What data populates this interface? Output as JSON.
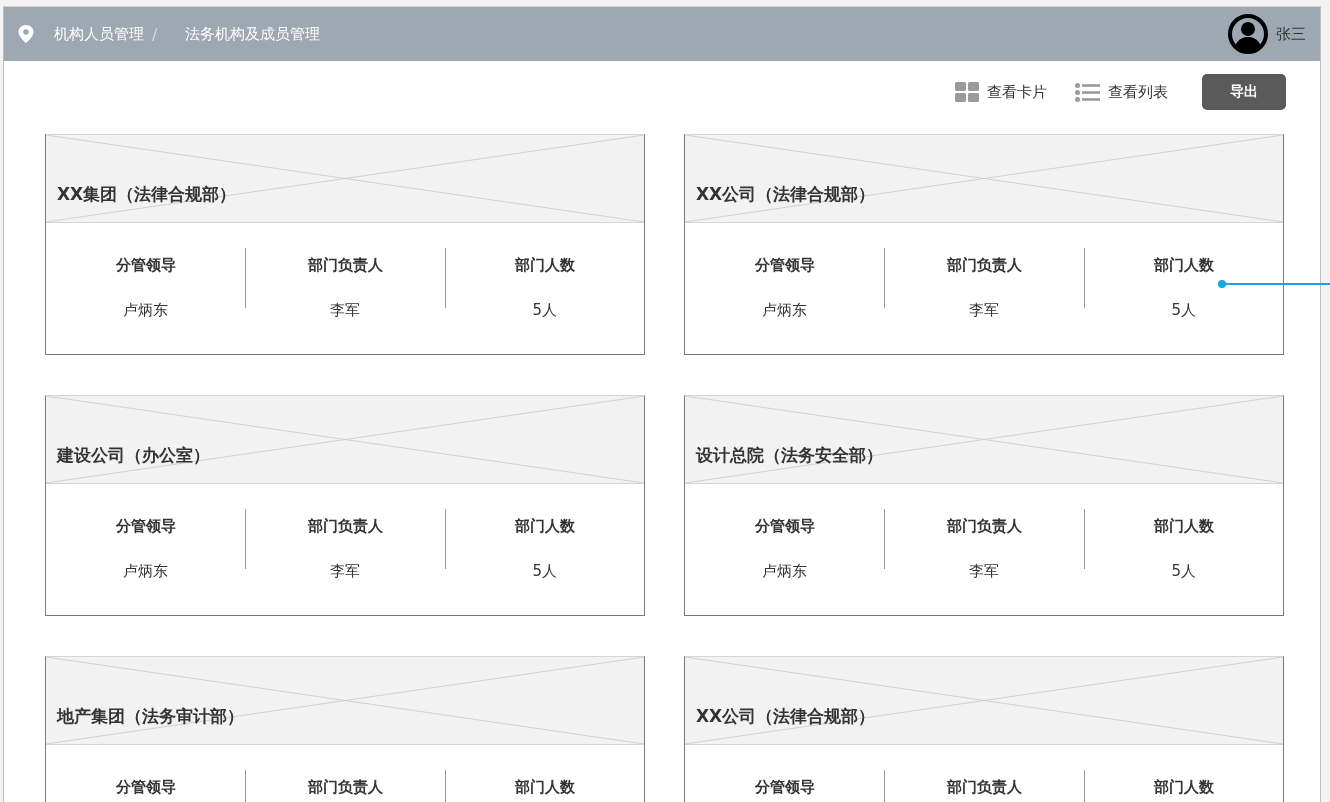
{
  "breadcrumb": [
    {
      "label": "机构人员管理"
    },
    {
      "label": "法务机构及成员管理"
    }
  ],
  "breadcrumb_separator": "/",
  "user": {
    "name": "张三"
  },
  "toolbar": {
    "view_options": [
      {
        "kind": "cards",
        "label": "查看卡片"
      },
      {
        "kind": "list",
        "label": "查看列表"
      }
    ],
    "export_button": "导出"
  },
  "cards": [
    {
      "title": "XX集团（法律合规部）",
      "stats": [
        {
          "label": "分管领导",
          "value": "卢炳东"
        },
        {
          "label": "部门负责人",
          "value": "李军"
        },
        {
          "label": "部门人数",
          "value": "5人"
        }
      ]
    },
    {
      "title": "XX公司（法律合规部）",
      "stats": [
        {
          "label": "分管领导",
          "value": "卢炳东"
        },
        {
          "label": "部门负责人",
          "value": "李军"
        },
        {
          "label": "部门人数",
          "value": "5人"
        }
      ]
    },
    {
      "title": "建设公司（办公室）",
      "stats": [
        {
          "label": "分管领导",
          "value": "卢炳东"
        },
        {
          "label": "部门负责人",
          "value": "李军"
        },
        {
          "label": "部门人数",
          "value": "5人"
        }
      ]
    },
    {
      "title": "设计总院（法务安全部）",
      "stats": [
        {
          "label": "分管领导",
          "value": "卢炳东"
        },
        {
          "label": "部门负责人",
          "value": "李军"
        },
        {
          "label": "部门人数",
          "value": "5人"
        }
      ]
    },
    {
      "title": "地产集团（法务审计部）",
      "stats": [
        {
          "label": "分管领导"
        },
        {
          "label": "部门负责人"
        },
        {
          "label": "部门人数"
        }
      ]
    },
    {
      "title": "XX公司（法律合规部）",
      "stats": [
        {
          "label": "分管领导"
        },
        {
          "label": "部门负责人"
        },
        {
          "label": "部门人数"
        }
      ]
    }
  ]
}
